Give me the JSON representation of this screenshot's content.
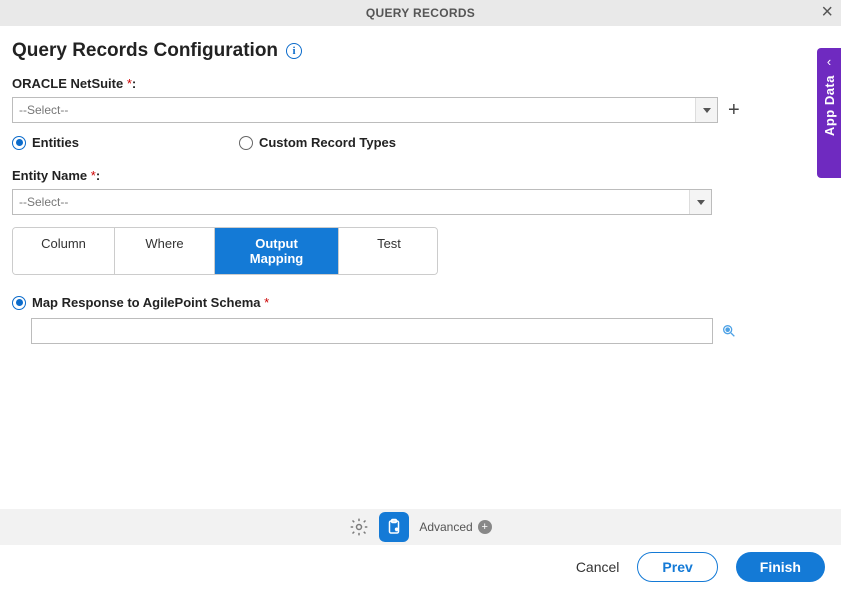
{
  "modal": {
    "title": "QUERY RECORDS"
  },
  "heading": "Query Records Configuration",
  "fields": {
    "netsuite_label": "ORACLE NetSuite ",
    "netsuite_value": "--Select--",
    "entity_name_label": "Entity Name ",
    "entity_name_value": "--Select--"
  },
  "radio": {
    "entities": "Entities",
    "custom": "Custom Record Types"
  },
  "tabs": {
    "column": "Column",
    "where": "Where",
    "output_mapping": "Output Mapping",
    "test": "Test"
  },
  "map": {
    "label": "Map Response to AgilePoint Schema ",
    "value": ""
  },
  "side_tab": "App Data",
  "footer": {
    "advanced": "Advanced",
    "cancel": "Cancel",
    "prev": "Prev",
    "finish": "Finish"
  }
}
